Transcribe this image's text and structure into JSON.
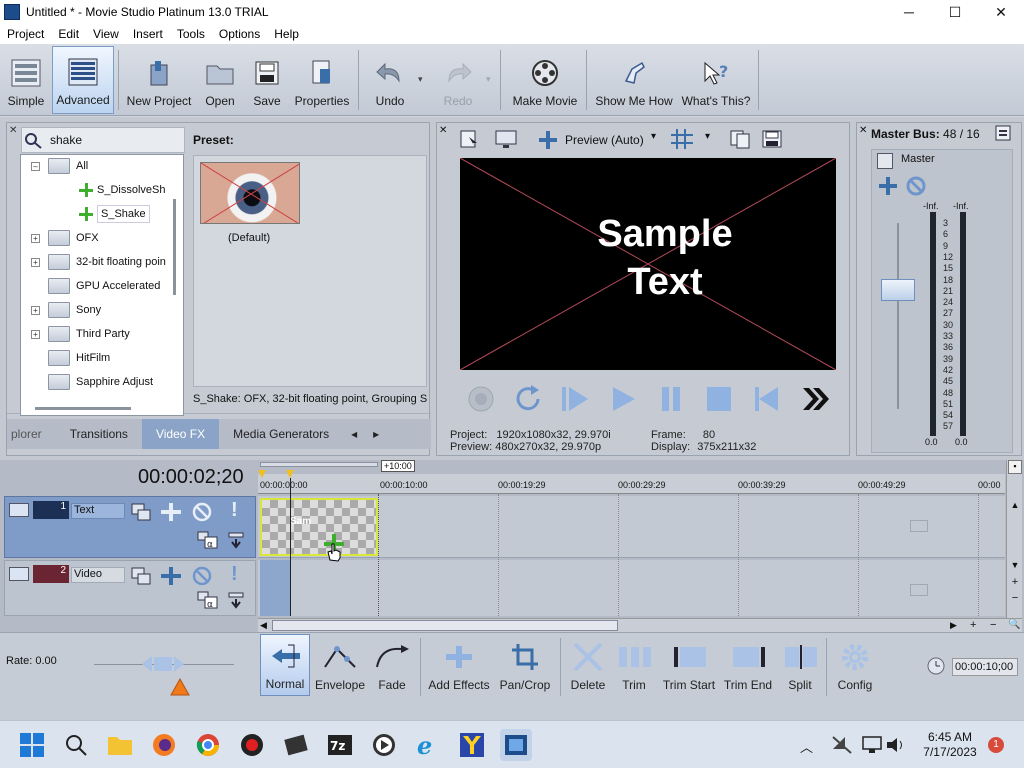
{
  "window": {
    "title": "Untitled * - Movie Studio Platinum 13.0 TRIAL",
    "min": "─",
    "max": "☐",
    "close": "✕"
  },
  "menu": [
    "Project",
    "Edit",
    "View",
    "Insert",
    "Tools",
    "Options",
    "Help"
  ],
  "toolbar": {
    "simple": "Simple",
    "advanced": "Advanced",
    "new_project": "New Project",
    "open": "Open",
    "save": "Save",
    "properties": "Properties",
    "undo": "Undo",
    "redo": "Redo",
    "make_movie": "Make Movie",
    "show_me_how": "Show Me How",
    "whats_this": "What's This?"
  },
  "fx_panel": {
    "search_value": "shake",
    "preset_label": "Preset:",
    "preset_name": "(Default)",
    "description": "S_Shake: OFX, 32-bit floating point, Grouping S",
    "tree": [
      "All",
      "S_DissolveSh",
      "S_Shake",
      "OFX",
      "32-bit floating poin",
      "GPU Accelerated",
      "Sony",
      "Third Party",
      "HitFilm",
      "Sapphire Adjust"
    ],
    "tabs": [
      "plorer",
      "Transitions",
      "Video FX",
      "Media Generators"
    ],
    "tab_nav_left": "◂",
    "tab_nav_right": "▸"
  },
  "preview": {
    "mode": "Preview (Auto)",
    "sample_line1": "Sample",
    "sample_line2": "Text",
    "project_label": "Project:",
    "project_value": "1920x1080x32, 29.970i",
    "preview_label": "Preview:",
    "preview_value": "480x270x32, 29.970p",
    "frame_label": "Frame:",
    "frame_value": "80",
    "display_label": "Display:",
    "display_value": "375x211x32"
  },
  "master": {
    "title": "Master Bus:",
    "value": "48 / 16",
    "label": "Master",
    "inf_left": "-Inf.",
    "inf_right": "-Inf.",
    "zero_left": "0.0",
    "zero_right": "0.0",
    "scale": [
      "3",
      "6",
      "9",
      "12",
      "15",
      "18",
      "21",
      "24",
      "27",
      "30",
      "33",
      "36",
      "39",
      "42",
      "45",
      "48",
      "51",
      "54",
      "57"
    ]
  },
  "timeline": {
    "timecode": "00:00:02;20",
    "zoom_badge": "+10:00",
    "ruler": [
      "00:00:00:00",
      "00:00:10:00",
      "00:00:19:29",
      "00:00:29:29",
      "00:00:39:29",
      "00:00:49:29",
      "00:00"
    ],
    "tracks": [
      {
        "num": "1",
        "name": "Text"
      },
      {
        "num": "2",
        "name": "Video"
      }
    ],
    "clip_text": "Sam",
    "rate": "Rate: 0.00",
    "end_time": "00:00:10;00"
  },
  "edit_tools": [
    "Normal",
    "Envelope",
    "Fade",
    "Add Effects",
    "Pan/Crop",
    "Delete",
    "Trim",
    "Trim Start",
    "Trim End",
    "Split",
    "Config"
  ],
  "taskbar": {
    "time": "6:45 AM",
    "date": "7/17/2023",
    "badge": "1"
  },
  "colors": {
    "accent": "#8aa3c6",
    "track_text": "#1c2f55",
    "track_video": "#6b2431",
    "orange": "#f07a1a"
  }
}
